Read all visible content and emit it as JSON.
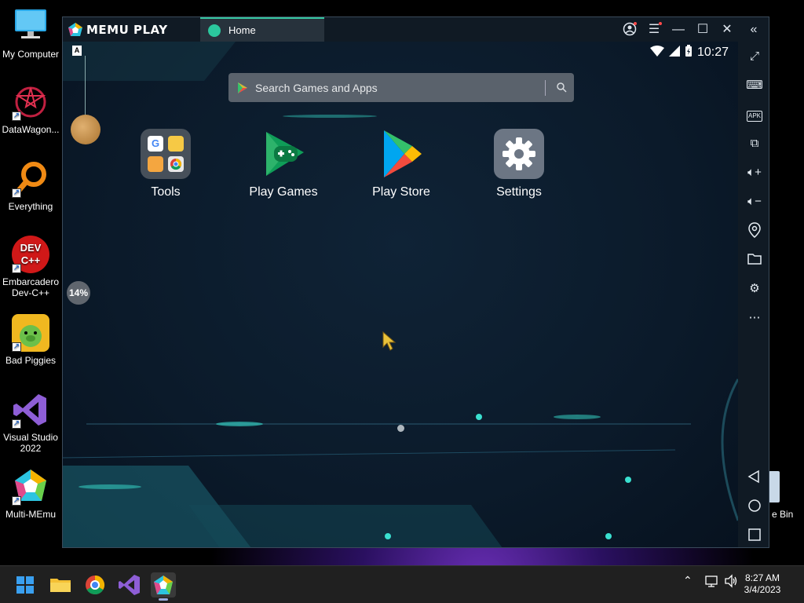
{
  "desktop": {
    "icons": [
      {
        "label": "My Computer",
        "icon": "computer-icon"
      },
      {
        "label": "DataWagon...",
        "icon": "datawagon-icon"
      },
      {
        "label": "Everything",
        "icon": "everything-search-icon"
      },
      {
        "label": "Embarcadero Dev-C++",
        "icon": "devcpp-icon"
      },
      {
        "label": "Bad Piggies",
        "icon": "bad-piggies-icon"
      },
      {
        "label": "Visual Studio 2022",
        "icon": "visual-studio-icon"
      },
      {
        "label": "Multi-MEmu",
        "icon": "multi-memu-icon"
      }
    ],
    "recycle_bin_partial_label": "e Bin",
    "dev_icon_text": "DEV C++"
  },
  "window": {
    "brand": "MEMU PLAY",
    "tab_label": "Home"
  },
  "android": {
    "time": "10:27",
    "floating_badge": "A",
    "progress_percent": "14%",
    "search_placeholder": "Search Games and Apps",
    "apps": [
      {
        "label": "Tools",
        "icon": "tools-folder-icon"
      },
      {
        "label": "Play Games",
        "icon": "play-games-icon"
      },
      {
        "label": "Play Store",
        "icon": "play-store-icon"
      },
      {
        "label": "Settings",
        "icon": "settings-gear-icon"
      }
    ]
  },
  "sidebar_tools": [
    "fullscreen-icon",
    "keyboard-icon",
    "apk-icon",
    "multi-window-icon",
    "volume-up-icon",
    "volume-down-icon",
    "location-icon",
    "folder-icon",
    "settings-icon",
    "more-icon",
    "back-icon",
    "home-icon",
    "recents-icon"
  ],
  "sidebar_apk_label": "APK",
  "taskbar": {
    "time": "8:27 AM",
    "date": "3/4/2023"
  },
  "colors": {
    "accent": "#35c6a0",
    "window_bg": "#101a24",
    "search_bg": "#5a626c"
  }
}
